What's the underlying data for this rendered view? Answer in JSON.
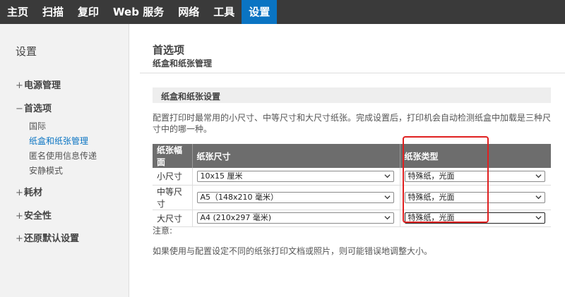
{
  "topnav": {
    "tabs": [
      {
        "label": "主页"
      },
      {
        "label": "扫描"
      },
      {
        "label": "复印"
      },
      {
        "label": "Web 服务"
      },
      {
        "label": "网络"
      },
      {
        "label": "工具"
      },
      {
        "label": "设置"
      }
    ],
    "active_index": 6,
    "active_color": "#0a74c3"
  },
  "sidebar": {
    "title": "设置",
    "groups": [
      {
        "sign": "+",
        "label": "电源管理"
      },
      {
        "sign": "−",
        "label": "首选项"
      },
      {
        "sign": "+",
        "label": "耗材"
      },
      {
        "sign": "+",
        "label": "安全性"
      },
      {
        "sign": "+",
        "label": "还原默认设置"
      }
    ],
    "subitems": [
      {
        "label": "国际"
      },
      {
        "label": "纸盒和纸张管理",
        "active": true
      },
      {
        "label": "匿名使用信息传递"
      },
      {
        "label": "安静模式"
      }
    ]
  },
  "main": {
    "title": "首选项",
    "subtitle": "纸盒和纸张管理",
    "section_title": "纸盒和纸张设置",
    "description": "配置打印时最常用的小尺寸、中等尺寸和大尺寸纸张。完成设置后，打印机会自动检测纸盒中加载是三种尺寸中的哪一种。",
    "table": {
      "headers": [
        "纸张幅面",
        "纸张尺寸",
        "纸张类型"
      ],
      "rows": [
        {
          "format": "小尺寸",
          "size": "10x15 厘米",
          "type": "特殊纸，光面"
        },
        {
          "format": "中等尺寸",
          "size": "A5（148x210 毫米）",
          "type": "特殊纸，光面"
        },
        {
          "format": "大尺寸",
          "size": "A4 (210x297 毫米)",
          "type": "特殊纸，光面"
        }
      ]
    },
    "note_label": "注意:",
    "note_text": "如果使用与配置设定不同的纸张打印文档或照片，则可能错误地调整大小。"
  },
  "highlight_color": "#e02020"
}
